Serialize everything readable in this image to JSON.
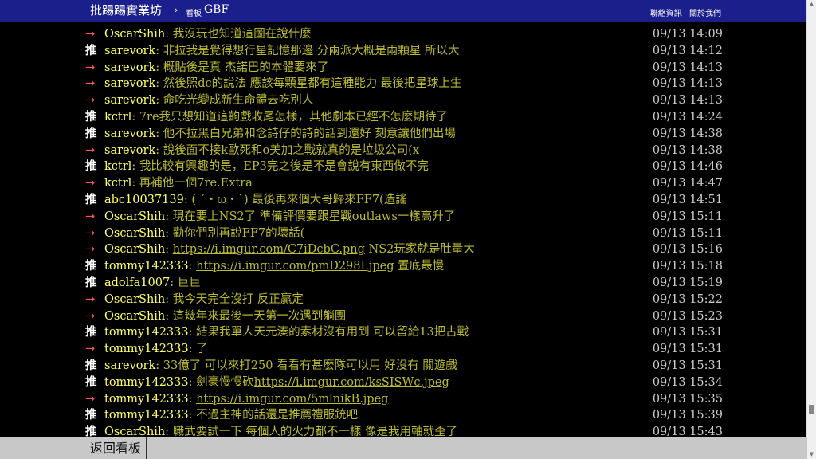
{
  "header": {
    "site_title": "批踢踢實業坊",
    "separator": "›",
    "board_label": "看板",
    "board_name": "GBF",
    "links": [
      "聯絡資訊",
      "關於我們"
    ]
  },
  "comments": [
    {
      "tag": "→",
      "kind": "arrow",
      "user": "OscarShih",
      "text": "我沒玩也知道這圖在說什麼",
      "time": "09/13 14:09"
    },
    {
      "tag": "推",
      "kind": "push",
      "user": "sarevork",
      "text": "非拉我是覺得想行星記憶那邊 分兩派大概是兩顆星 所以大",
      "time": "09/13 14:12"
    },
    {
      "tag": "→",
      "kind": "arrow",
      "user": "sarevork",
      "text": "概貼後是真 杰諾巴的本體要來了",
      "time": "09/13 14:13"
    },
    {
      "tag": "→",
      "kind": "arrow",
      "user": "sarevork",
      "text": "然後照dc的說法 應該每顆星都有這種能力 最後把星球上生",
      "time": "09/13 14:13"
    },
    {
      "tag": "→",
      "kind": "arrow",
      "user": "sarevork",
      "text": "命吃光變成新生命體去吃別人",
      "time": "09/13 14:13"
    },
    {
      "tag": "推",
      "kind": "push",
      "user": "kctrl",
      "text": "7re我只想知道這齣戲收尾怎樣，其他劇本已經不怎麼期待了",
      "time": "09/13 14:24"
    },
    {
      "tag": "推",
      "kind": "push",
      "user": "sarevork",
      "text": "他不拉黑白兄弟和念詩仔的詩的話到還好 刻意讓他們出場",
      "time": "09/13 14:38"
    },
    {
      "tag": "→",
      "kind": "arrow",
      "user": "sarevork",
      "text": "說後面不接k歐死和o美加之戰就真的是垃圾公司(x",
      "time": "09/13 14:38"
    },
    {
      "tag": "推",
      "kind": "push",
      "user": "kctrl",
      "text": "我比較有興趣的是，EP3完之後是不是會說有東西做不完",
      "time": "09/13 14:46"
    },
    {
      "tag": "→",
      "kind": "arrow",
      "user": "kctrl",
      "text": "再補他一個7re.Extra",
      "time": "09/13 14:47"
    },
    {
      "tag": "推",
      "kind": "push",
      "user": "abc10037139",
      "text": "( ´・ω・`) 最後再來個大哥歸來FF7(造謠",
      "time": "09/13 14:51"
    },
    {
      "tag": "→",
      "kind": "arrow",
      "user": "OscarShih",
      "text": "現在要上NS2了 準備評價要跟星戰outlaws一樣高升了",
      "time": "09/13 15:11"
    },
    {
      "tag": "→",
      "kind": "arrow",
      "user": "OscarShih",
      "text": "勸你們別再說FF7的壞話(",
      "time": "09/13 15:11"
    },
    {
      "tag": "→",
      "kind": "arrow",
      "user": "OscarShih",
      "link": "https://i.imgur.com/C7iDcbC.png",
      "text": " NS2玩家就是肚量大",
      "time": "09/13 15:16"
    },
    {
      "tag": "推",
      "kind": "push",
      "user": "tommy142333",
      "link": "https://i.imgur.com/pmD298I.jpeg",
      "text": " 置底最慢",
      "time": "09/13 15:18"
    },
    {
      "tag": "推",
      "kind": "push",
      "user": "adolfa1007",
      "text": "巨巨",
      "time": "09/13 15:19"
    },
    {
      "tag": "→",
      "kind": "arrow",
      "user": "OscarShih",
      "text": "我今天完全沒打 反正贏定",
      "time": "09/13 15:22"
    },
    {
      "tag": "→",
      "kind": "arrow",
      "user": "OscarShih",
      "text": "這幾年來最後一天第一次遇到躺團",
      "time": "09/13 15:23"
    },
    {
      "tag": "推",
      "kind": "push",
      "user": "tommy142333",
      "text": "結果我單人天元湊的素材沒有用到 可以留給13把古戰",
      "time": "09/13 15:31"
    },
    {
      "tag": "→",
      "kind": "arrow",
      "user": "tommy142333",
      "text": "了",
      "time": "09/13 15:31"
    },
    {
      "tag": "推",
      "kind": "push",
      "user": "sarevork",
      "text": "33億了 可以來打250 看看有甚麼隊可以用 好沒有 關遊戲",
      "time": "09/13 15:31"
    },
    {
      "tag": "推",
      "kind": "push",
      "user": "tommy142333",
      "text": "劍豪慢慢砍",
      "link_after": "https://i.imgur.com/ksSISWc.jpeg",
      "time": "09/13 15:34"
    },
    {
      "tag": "→",
      "kind": "arrow",
      "user": "tommy142333",
      "link": "https://i.imgur.com/5mlnikB.jpeg",
      "text": "",
      "time": "09/13 15:35"
    },
    {
      "tag": "推",
      "kind": "push",
      "user": "tommy142333",
      "text": "不過主神的話還是推薦禮服銃吧",
      "time": "09/13 15:39"
    },
    {
      "tag": "推",
      "kind": "push",
      "user": "OscarShih",
      "text": "職武要試一下 每個人的火力都不一樣 像是我用軸就歪了",
      "time": "09/13 15:43"
    }
  ],
  "footer": {
    "back_label": "返回看板"
  }
}
